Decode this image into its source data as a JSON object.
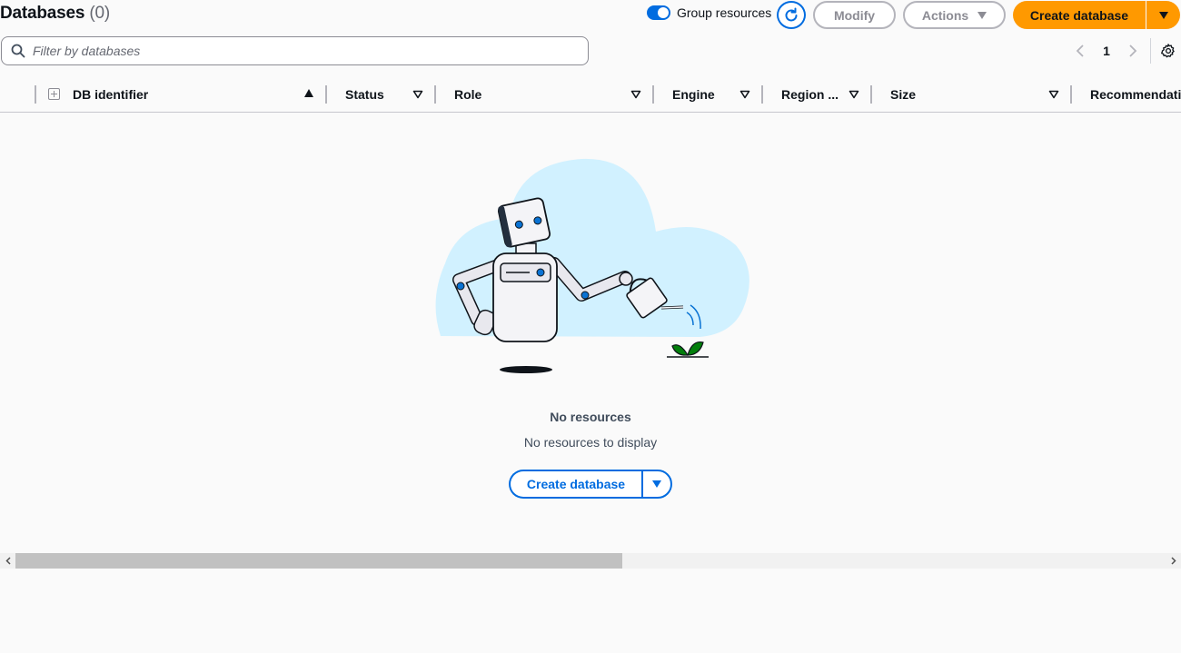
{
  "header": {
    "title": "Databases",
    "count": "(0)",
    "group_toggle_label": "Group resources",
    "group_toggle_on": true,
    "modify_label": "Modify",
    "actions_label": "Actions",
    "create_label": "Create database"
  },
  "filter": {
    "placeholder": "Filter by databases",
    "value": ""
  },
  "pagination": {
    "current_page": "1"
  },
  "table": {
    "columns": [
      "DB identifier",
      "Status",
      "Role",
      "Engine",
      "Region ...",
      "Size",
      "Recommendations"
    ],
    "sorted_column": "DB identifier",
    "sort_direction": "ascending"
  },
  "empty_state": {
    "title": "No resources",
    "description": "No resources to display",
    "create_label": "Create database"
  },
  "icons": {
    "search": "search-icon",
    "refresh": "refresh-icon",
    "settings": "gear-icon",
    "expand": "expand-all-icon"
  },
  "colors": {
    "primary": "#ff9900",
    "link_blue": "#006ce0",
    "cloud": "#d1f1ff",
    "leaf": "#037f0c"
  }
}
